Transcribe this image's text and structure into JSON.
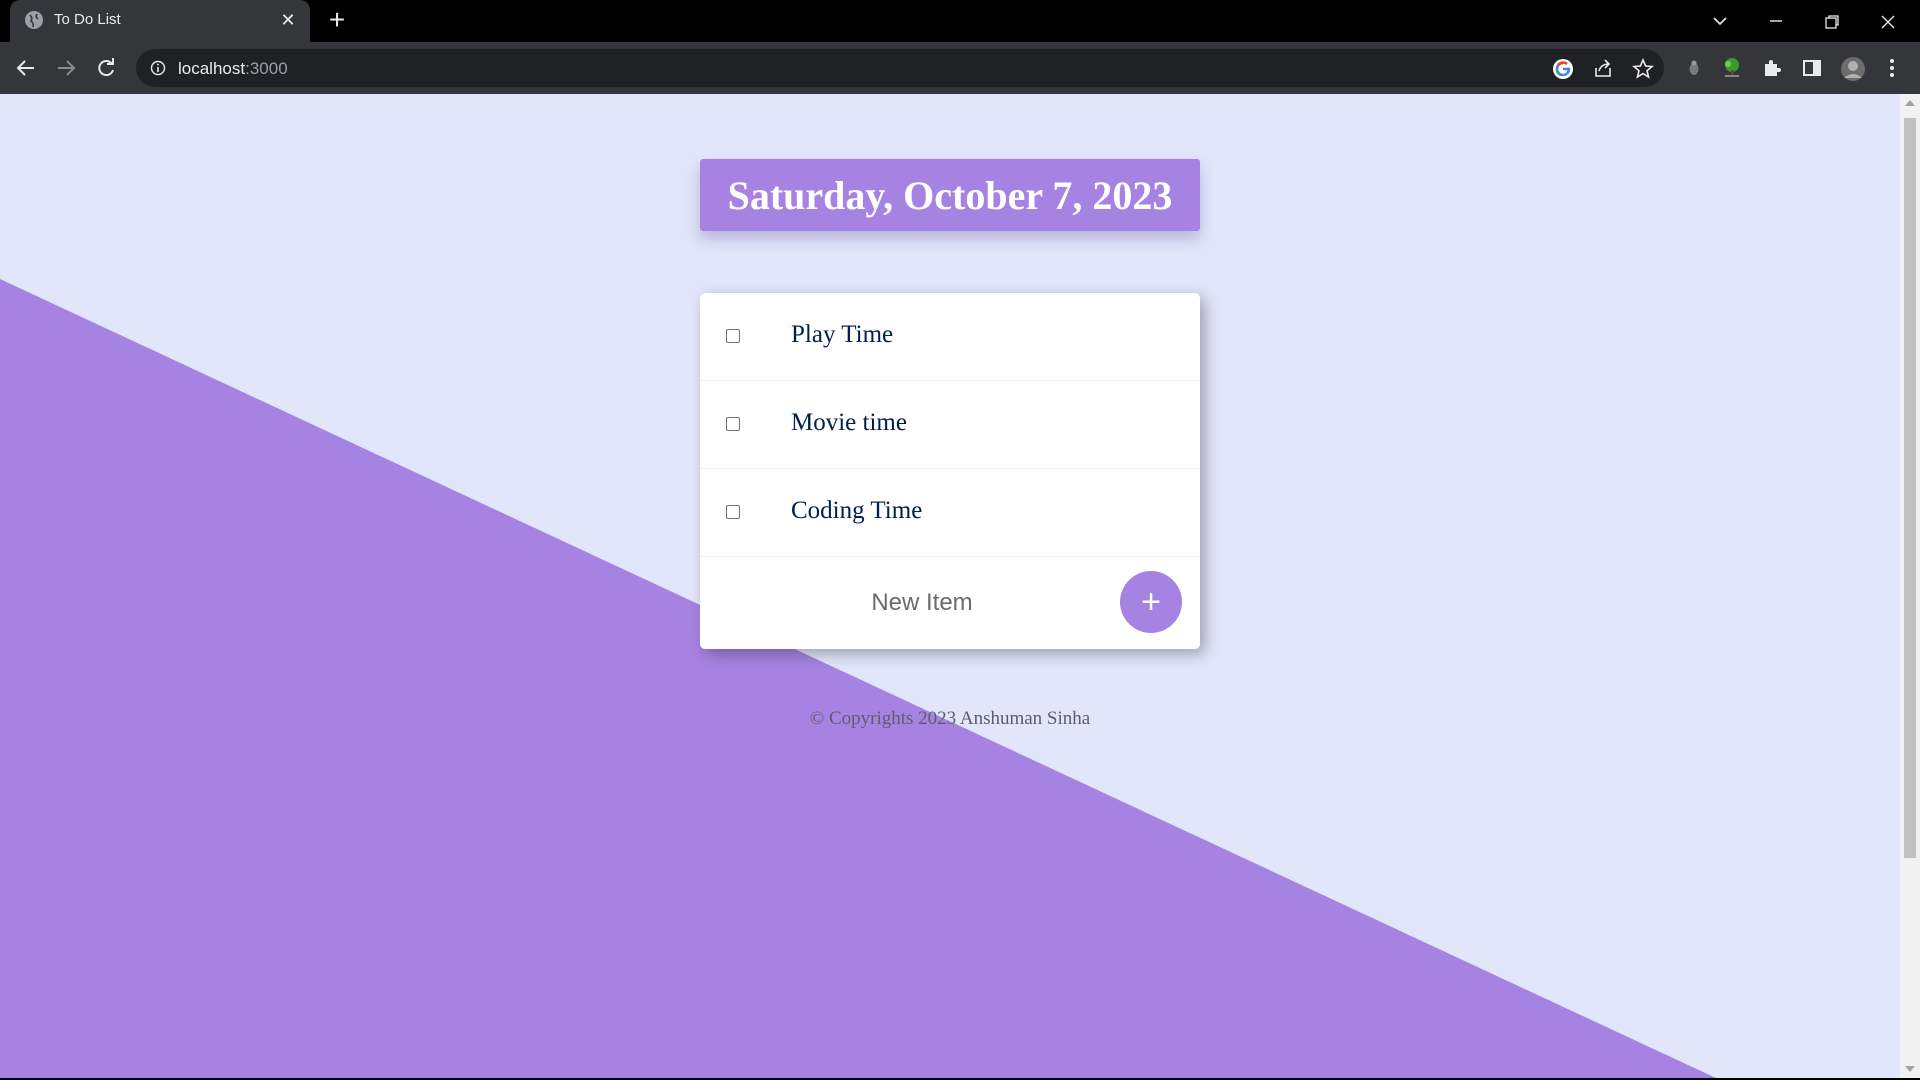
{
  "browser": {
    "tab_title": "To Do List",
    "tab_close": "✕",
    "new_tab": "+",
    "url_host": "localhost",
    "url_port": ":3000"
  },
  "page": {
    "date_heading": "Saturday, October 7, 2023",
    "items": [
      {
        "label": "Play Time",
        "checked": false
      },
      {
        "label": "Movie time",
        "checked": false
      },
      {
        "label": "Coding Time",
        "checked": false
      }
    ],
    "new_item_placeholder": "New Item",
    "add_button_label": "+",
    "footer": "© Copyrights 2023 Anshuman Sinha"
  },
  "colors": {
    "accent_purple": "#a683e3",
    "page_background": "#e1e6fa",
    "item_text": "#00204a"
  },
  "icons": [
    "globe-icon",
    "back-icon",
    "forward-icon",
    "reload-icon",
    "info-icon",
    "google-icon",
    "share-icon",
    "star-icon",
    "extension-icon",
    "puzzle-icon",
    "side-panel-icon",
    "profile-avatar",
    "menu-icon"
  ]
}
